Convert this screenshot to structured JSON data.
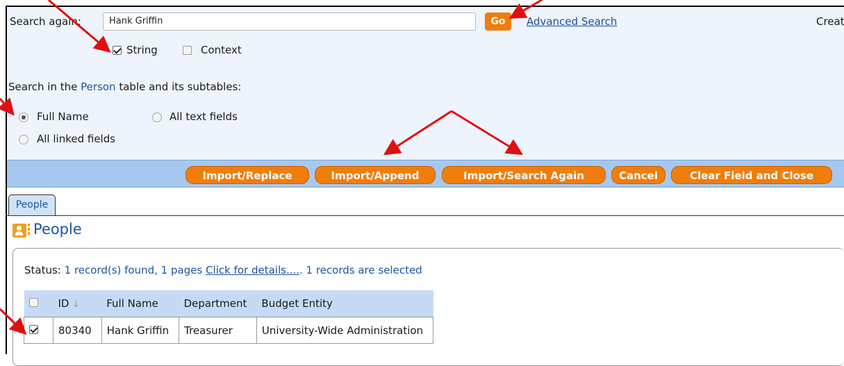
{
  "search": {
    "label": "Search again:",
    "value": "Hank Griffin",
    "go_label": "Go",
    "advanced_link": "Advanced Search",
    "create_label": "Create",
    "string_label": "String",
    "string_checked": true,
    "context_label": "Context",
    "context_checked": false
  },
  "scope": {
    "prefix": "Search in the",
    "table_name": "Person",
    "suffix": "table and its subtables:",
    "options": [
      {
        "label": "Full Name",
        "selected": true
      },
      {
        "label": "All text fields",
        "selected": false
      },
      {
        "label": "All linked fields",
        "selected": false
      }
    ]
  },
  "toolbar": {
    "buttons": [
      "Import/Replace",
      "Import/Append",
      "Import/Search Again",
      "Cancel",
      "Clear Field and Close"
    ]
  },
  "tabs": [
    {
      "label": "People",
      "active": true
    }
  ],
  "section": {
    "title": "People",
    "icon": "address-book-icon"
  },
  "status": {
    "prefix": "Status:",
    "text": "1 record(s) found, 1 pages",
    "details_link": "Click for details....",
    "selected_text": ". 1 records are selected"
  },
  "table": {
    "columns": [
      "ID",
      "Full Name",
      "Department",
      "Budget Entity"
    ],
    "sort_indicator": "↓",
    "rows": [
      {
        "checked": true,
        "id": "80340",
        "full_name": "Hank Griffin",
        "department": "Treasurer",
        "budget_entity": "University-Wide Administration"
      }
    ]
  },
  "colors": {
    "accent_orange": "#f07d0c",
    "toolbar_blue": "#a7c8ee",
    "link_blue": "#1a56a0",
    "annotation_red": "#e01010"
  }
}
